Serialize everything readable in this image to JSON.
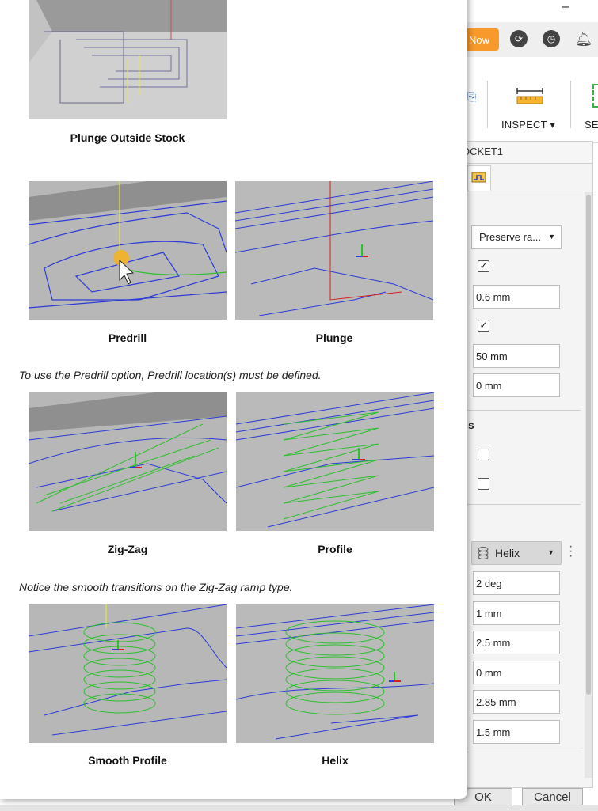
{
  "window": {
    "minimize": "–",
    "close_partial": ""
  },
  "header": {
    "now_label": "Now"
  },
  "toolbar": {
    "inspect_label": "INSPECT ▾",
    "select_label_partial": "SE"
  },
  "panel": {
    "tab_title": "OCKET1",
    "ramp_type_select": "Preserve ra...",
    "field_1": "0.6 mm",
    "field_2": "50 mm",
    "field_3": "0 mm",
    "section_label_partial": "s",
    "ramp_mode_select": "Helix",
    "field_ramp_angle": "2 deg",
    "field_ramp_max_stepdown": "1 mm",
    "field_ramp_clearance": "2.5 mm",
    "field_ramp_taper": "0 mm",
    "field_helix_diameter": "2.85 mm",
    "field_min_ramp_diameter": "1.5 mm",
    "checkbox_1": true,
    "checkbox_2": true,
    "checkbox_3": false,
    "checkbox_4": false,
    "ok_label": "OK",
    "cancel_label": "Cancel"
  },
  "help": {
    "plunge_outside_stock": "Plunge Outside Stock",
    "predrill": "Predrill",
    "plunge": "Plunge",
    "note_predrill": "To use the Predrill option, Predrill location(s) must be defined.",
    "zigzag": "Zig-Zag",
    "profile": "Profile",
    "note_zigzag": "Notice the smooth transitions on the Zig-Zag ramp type.",
    "smooth_profile": "Smooth Profile",
    "helix": "Helix"
  },
  "colors": {
    "accent_orange": "#f89a2b",
    "toolpath_blue": "#2b3bd6",
    "ramp_green": "#2fbf2f",
    "plunge_red": "#d52020"
  }
}
